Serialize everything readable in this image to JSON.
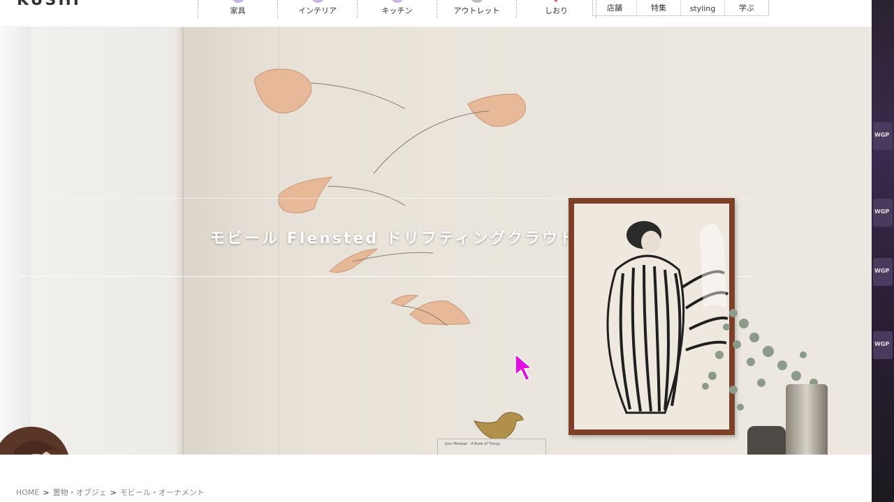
{
  "header": {
    "logo_text": "KUSHI",
    "nav_main": [
      {
        "label": "家具",
        "icon": "cushion-icon"
      },
      {
        "label": "インテリア",
        "icon": "lamp-icon"
      },
      {
        "label": "キッチン",
        "icon": "pan-icon"
      },
      {
        "label": "アウトレット",
        "icon": "tag-icon"
      },
      {
        "label": "しおり",
        "icon": "star-icon"
      }
    ],
    "nav_sub": [
      {
        "label": "店舗"
      },
      {
        "label": "特集"
      },
      {
        "label": "styling"
      },
      {
        "label": "学ぶ"
      }
    ]
  },
  "hero": {
    "title": "モビール Flensted ドリフティングクラウド",
    "book_text": "Joan Marlaan · A Book of Things"
  },
  "breadcrumb": {
    "items": [
      "HOME",
      "置物・オブジェ",
      "モビール・オーナメント"
    ],
    "separator": ">"
  },
  "side_panel": {
    "tile_labels": [
      "WGP",
      "WGP",
      "WGP",
      "WGP"
    ]
  },
  "colors": {
    "accent_bar": "#6a3fb3",
    "cursor": "#e010e0",
    "frame": "#7c4028"
  }
}
